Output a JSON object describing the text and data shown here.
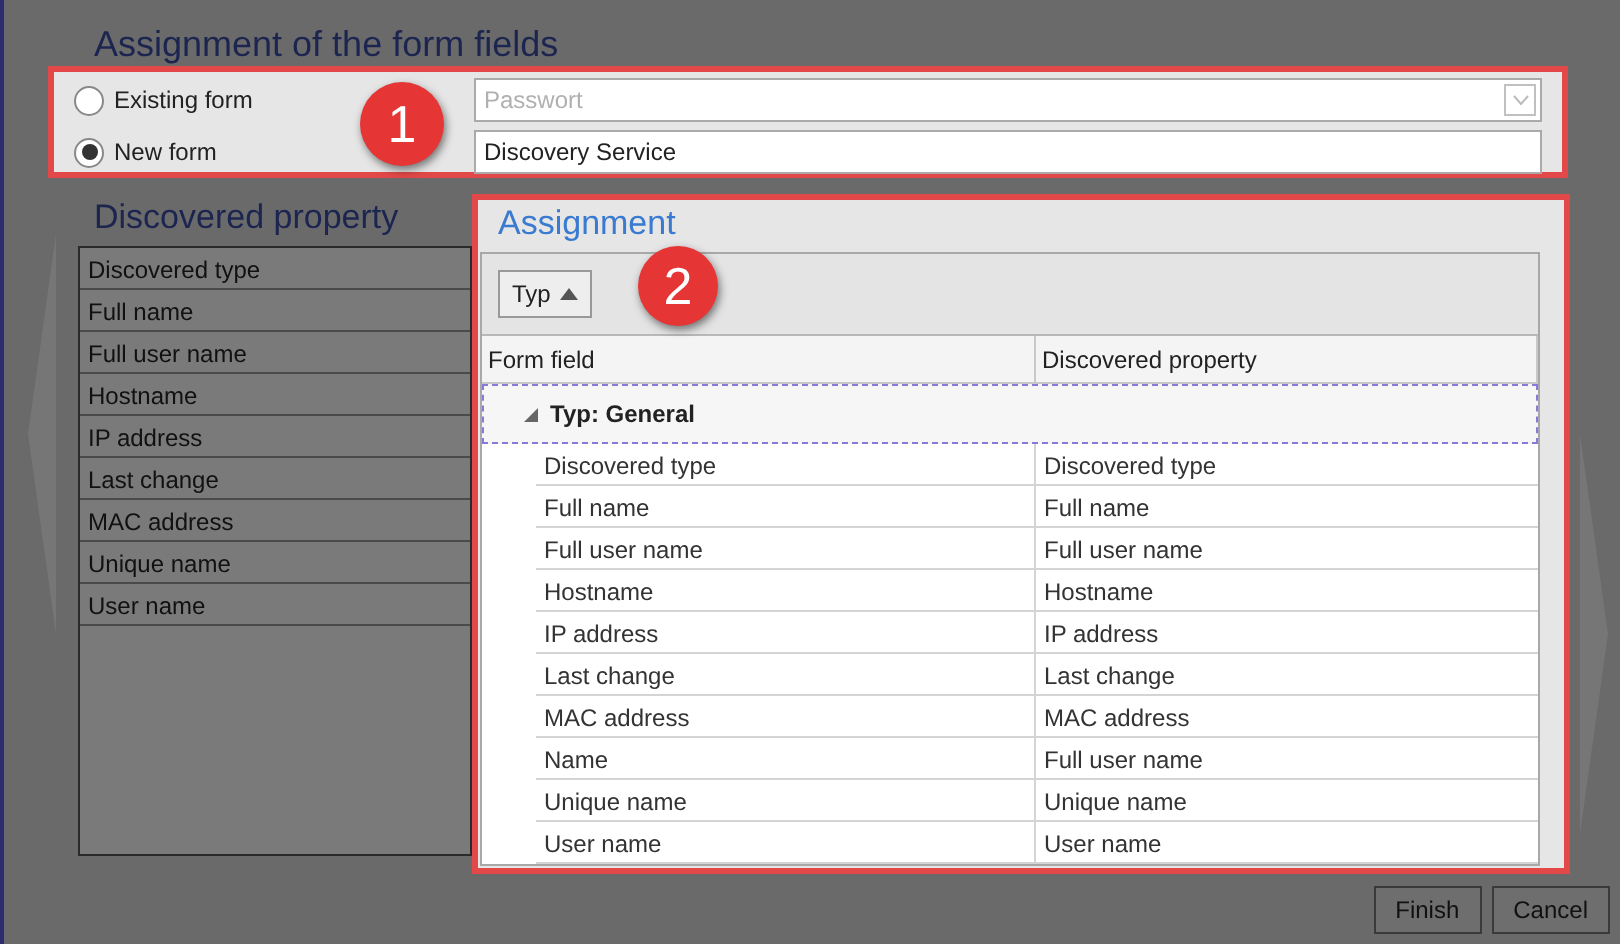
{
  "title": "Assignment of the form fields",
  "form_choice": {
    "callout": "1",
    "options": [
      {
        "label": "Existing form",
        "selected": false
      },
      {
        "label": "New form",
        "selected": true
      }
    ],
    "existing_form": {
      "value": "Passwort",
      "disabled": true
    },
    "new_form_name": "Discovery Service"
  },
  "discovered_property": {
    "title": "Discovered property",
    "items": [
      "Discovered type",
      "Full name",
      "Full user name",
      "Hostname",
      "IP address",
      "Last change",
      "MAC address",
      "Unique name",
      "User name"
    ]
  },
  "assignment": {
    "title": "Assignment",
    "callout": "2",
    "group_by": {
      "label": "Typ"
    },
    "columns": [
      "Form field",
      "Discovered property"
    ],
    "groups": [
      {
        "label": "Typ: General",
        "expanded": true,
        "rows": [
          {
            "form_field": "Discovered type",
            "property": "Discovered type"
          },
          {
            "form_field": "Full name",
            "property": "Full name"
          },
          {
            "form_field": "Full user name",
            "property": "Full user name"
          },
          {
            "form_field": "Hostname",
            "property": "Hostname"
          },
          {
            "form_field": "IP address",
            "property": "IP address"
          },
          {
            "form_field": "Last change",
            "property": "Last change"
          },
          {
            "form_field": "MAC address",
            "property": "MAC address"
          },
          {
            "form_field": "Name",
            "property": "Full user name"
          },
          {
            "form_field": "Unique name",
            "property": "Unique name"
          },
          {
            "form_field": "User name",
            "property": "User name"
          }
        ]
      }
    ]
  },
  "buttons": [
    "Finish",
    "Cancel"
  ]
}
